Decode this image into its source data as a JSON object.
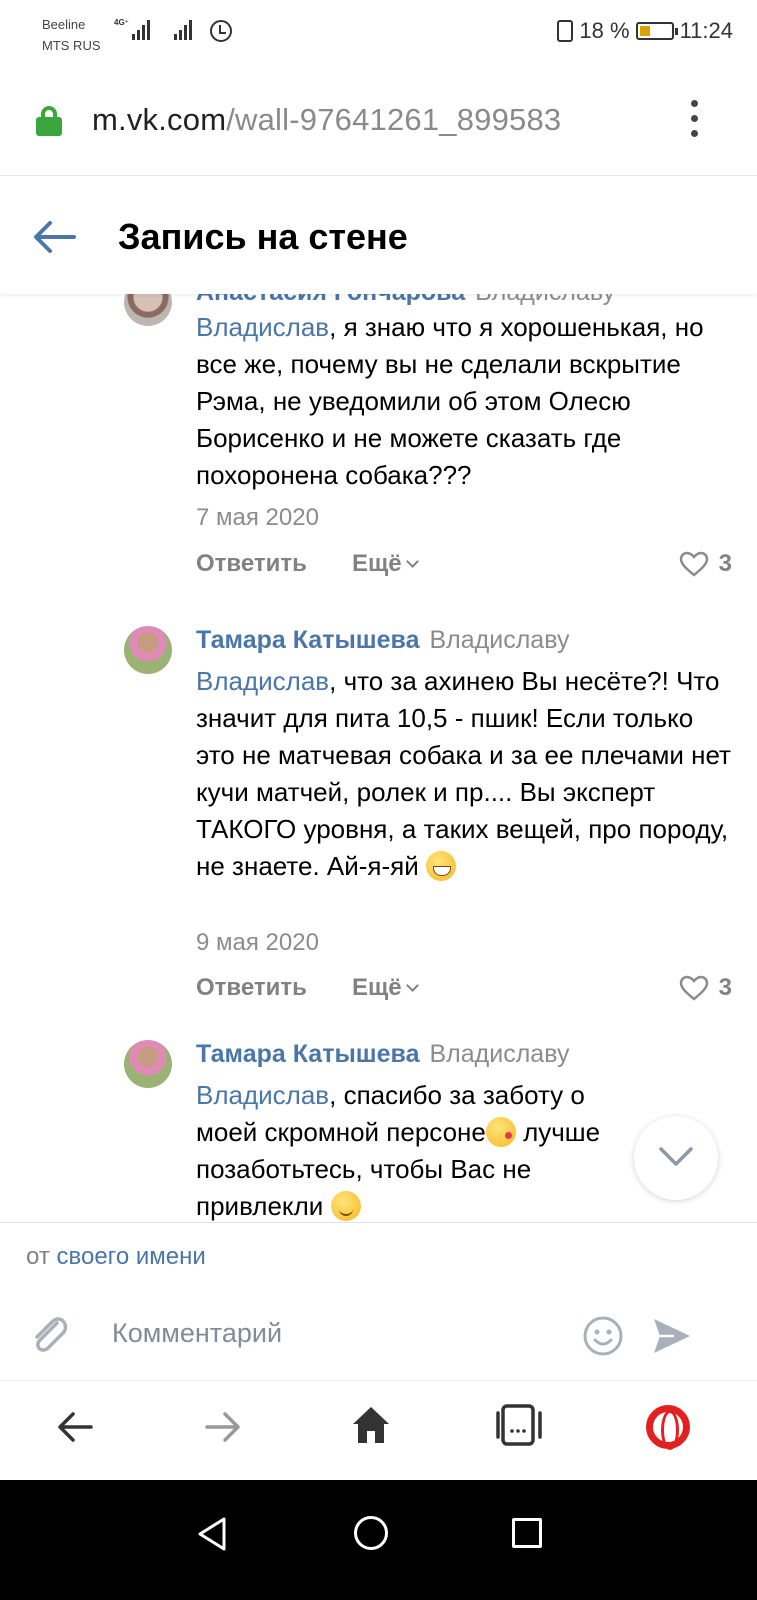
{
  "status_bar": {
    "carrier_1": "Beeline",
    "carrier_2": "MTS RUS",
    "network": "4G⁺",
    "battery_percent": "18 %",
    "time": "11:24"
  },
  "url_bar": {
    "host": "m.vk.com",
    "path": "/wall-97641261_899583"
  },
  "header": {
    "title": "Запись на стене"
  },
  "comments": [
    {
      "author": "Анастасия Гончарова",
      "to": "Владиславу",
      "mention": "Владислав",
      "text": ", я знаю что я хорошенькая, но все же, почему вы не сделали вскрытие Рэма, не уведомили об этом Олесю Борисенко и не можете сказать где похоронена собака???",
      "date": "7 мая 2020",
      "reply_label": "Ответить",
      "more_label": "Ещё",
      "likes": "3"
    },
    {
      "author": "Тамара Катышева",
      "to": "Владиславу",
      "mention": "Владислав",
      "text": ", что за ахинею Вы несёте?! Что значит для пита 10,5 - пшик! Если только это не матчевая собака и за ее плечами нет кучи матчей, ролек и пр.... Вы эксперт ТАКОГО уровня, а таких вещей, про породу, не знаете. Ай-я-яй",
      "date": "9 мая 2020",
      "reply_label": "Ответить",
      "more_label": "Ещё",
      "likes": "3"
    },
    {
      "author": "Тамара Катышева",
      "to": "Владиславу",
      "mention": "Владислав",
      "text_part1": ", спасибо за заботу о моей скромной персоне",
      "text_part2": " лучше позаботьтесь, чтобы Вас не привлекли"
    }
  ],
  "composer": {
    "from_prefix": "от",
    "from_name": "своего имени",
    "placeholder": "Комментарий"
  },
  "colors": {
    "link": "#4a76a8",
    "secure_lock": "#3ba53e",
    "opera_red": "#e1201f"
  }
}
